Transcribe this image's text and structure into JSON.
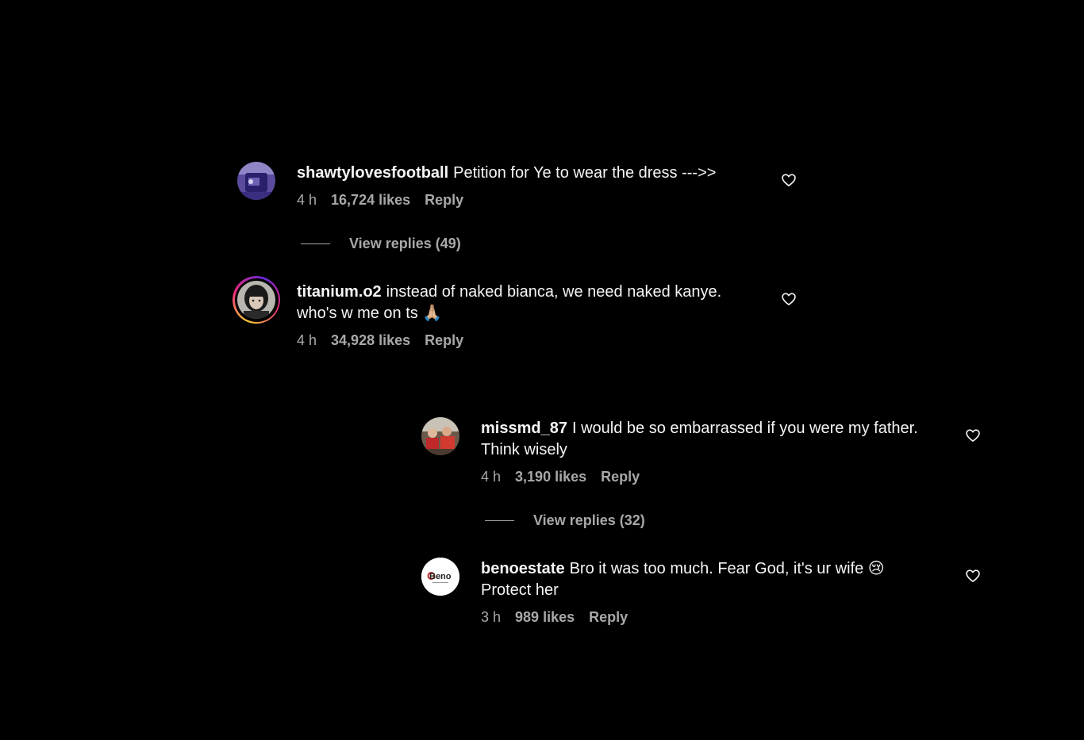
{
  "comments": [
    {
      "username": "shawtylovesfootball",
      "text": "Petition for Ye to wear the dress --->>",
      "time": "4 h",
      "likes": "16,724 likes",
      "reply_label": "Reply",
      "avatar_colors": [
        "#3b2a7a",
        "#8a7cc9"
      ]
    },
    {
      "username": "titanium.o2",
      "text": "instead of naked bianca, we need naked kanye. who's w me on ts 🙏🏼",
      "time": "4 h",
      "likes": "34,928 likes",
      "reply_label": "Reply"
    },
    {
      "username": "missmd_87",
      "text": "I would be so embarrassed if you were my father. Think wisely",
      "time": "4 h",
      "likes": "3,190 likes",
      "reply_label": "Reply"
    },
    {
      "username": "benoestate",
      "text": "Bro it was too much. Fear God, it's ur wife 😢 Protect her",
      "time": "3 h",
      "likes": "989 likes",
      "reply_label": "Reply",
      "avatar_logo_text": "Beno"
    }
  ],
  "view_replies": [
    {
      "label": "View replies (49)"
    },
    {
      "label": "View replies (32)"
    }
  ],
  "icons": {
    "like": "heart-icon"
  },
  "colors": {
    "background": "#000000",
    "primary_text": "#f5f5f5",
    "secondary_text": "#a8a8a8"
  }
}
